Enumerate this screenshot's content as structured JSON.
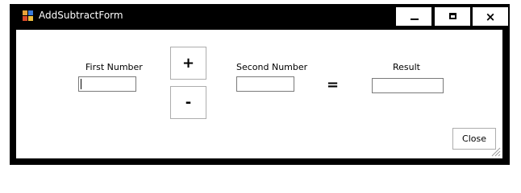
{
  "window": {
    "title": "AddSubtractForm",
    "icon": "form-app-icon",
    "controls": {
      "minimize": "minimize-icon",
      "maximize": "maximize-icon",
      "close": "×"
    }
  },
  "form": {
    "first_label": "First Number",
    "first_value": "",
    "add_label": "+",
    "subtract_label": "-",
    "second_label": "Second Number",
    "second_value": "",
    "equals": "=",
    "result_label": "Result",
    "result_value": "",
    "close_label": "Close"
  }
}
